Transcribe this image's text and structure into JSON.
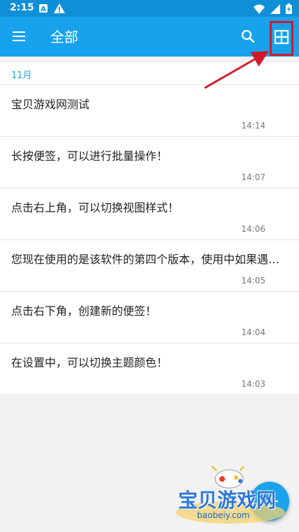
{
  "status_bar": {
    "time": "2:15",
    "icons_left": [
      "a-icon",
      "warning-icon"
    ],
    "icons_right": [
      "wifi-icon",
      "signal-icon",
      "battery-icon"
    ]
  },
  "app_bar": {
    "title": "全部",
    "menu_icon": "menu-icon",
    "search_icon": "search-icon",
    "grid_icon": "grid-view-icon"
  },
  "section": {
    "label": "11月"
  },
  "notes": [
    {
      "text": "宝贝游戏网测试",
      "time": "14:14"
    },
    {
      "text": "长按便签，可以进行批量操作！",
      "time": "14:07"
    },
    {
      "text": "点击右上角，可以切换视图样式！",
      "time": "14:06"
    },
    {
      "text": "您现在使用的是该软件的第四个版本，使用中如果遇到...",
      "time": "14:05"
    },
    {
      "text": "点击右下角，创建新的便签！",
      "time": "14:04"
    },
    {
      "text": "在设置中，可以切换主题颜色！",
      "time": "14:03"
    }
  ],
  "fab": {
    "icon": "plus-icon"
  },
  "watermark": {
    "text": "宝贝游戏网",
    "url": "baobeiy.com"
  },
  "colors": {
    "status_bar": "#0f8fd6",
    "app_bar": "#17a2ee",
    "accent": "#21a6e3",
    "highlight": "#d21a2a"
  }
}
